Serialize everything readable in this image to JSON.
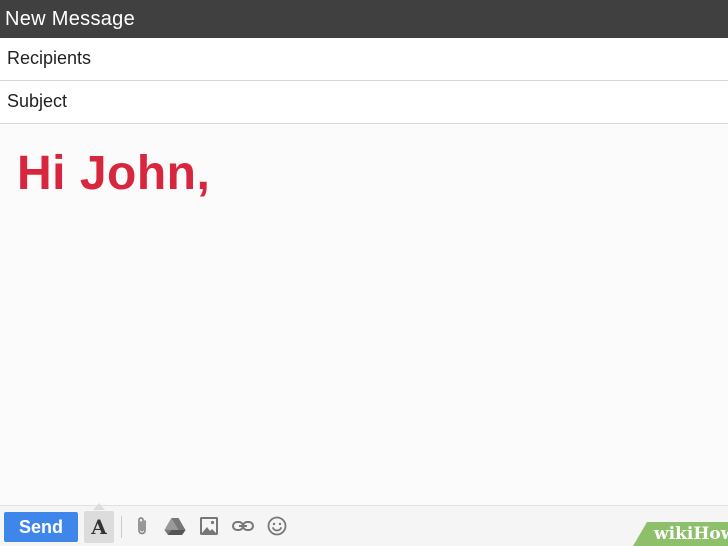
{
  "window": {
    "title": "New Message"
  },
  "fields": {
    "recipients_placeholder": "Recipients",
    "subject_placeholder": "Subject"
  },
  "body": {
    "text": "Hi John,"
  },
  "toolbar": {
    "send_label": "Send",
    "format_label": "A",
    "icons": [
      "attach-icon",
      "drive-icon",
      "photo-icon",
      "link-icon",
      "emoji-icon"
    ]
  },
  "watermark": {
    "prefix": "wiki",
    "suffix": "How"
  },
  "colors": {
    "title_bar": "#404040",
    "send_button": "#3f86ea",
    "greeting_text": "#d7263d",
    "watermark_bg": "#8ec06c"
  }
}
